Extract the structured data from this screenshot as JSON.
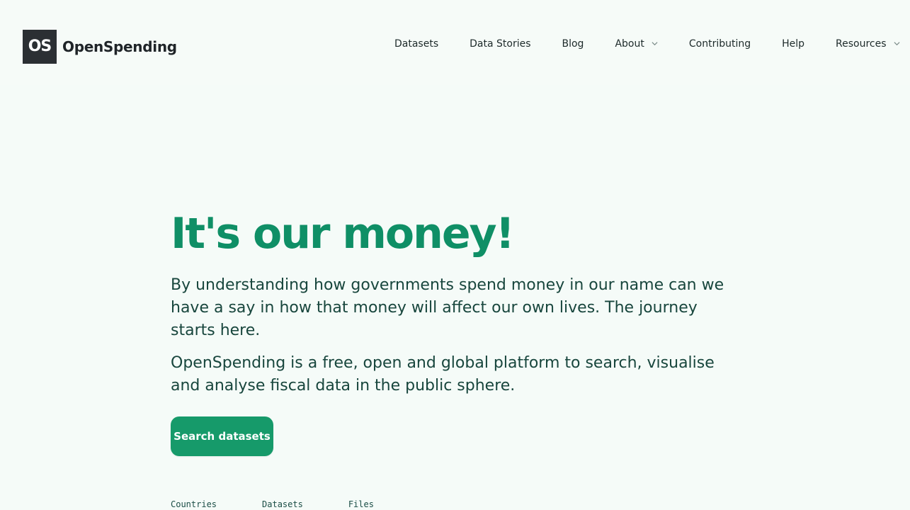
{
  "header": {
    "logo_text": "OS",
    "brand_name": "OpenSpending",
    "nav": [
      {
        "label": "Datasets",
        "dropdown": false
      },
      {
        "label": "Data Stories",
        "dropdown": false
      },
      {
        "label": "Blog",
        "dropdown": false
      },
      {
        "label": "About",
        "dropdown": true
      },
      {
        "label": "Contributing",
        "dropdown": false
      },
      {
        "label": "Help",
        "dropdown": false
      },
      {
        "label": "Resources",
        "dropdown": true
      }
    ]
  },
  "hero": {
    "title": "It's our money!",
    "lead": "By understanding how governments spend money in our name can we have a say in how that money will affect our own lives. The journey starts here.",
    "description": "OpenSpending is a free, open and global platform to search, visualise and analyse fiscal data in the public sphere.",
    "cta_label": "Search datasets"
  },
  "stats": [
    {
      "label": "Countries"
    },
    {
      "label": "Datasets"
    },
    {
      "label": "Files"
    }
  ],
  "colors": {
    "accent": "#169a6a",
    "title": "#0f8f66",
    "background": "#f5fbf8",
    "logo_bg": "#2b2f33"
  },
  "icons": {
    "dropdown": "chevron-down-icon"
  }
}
